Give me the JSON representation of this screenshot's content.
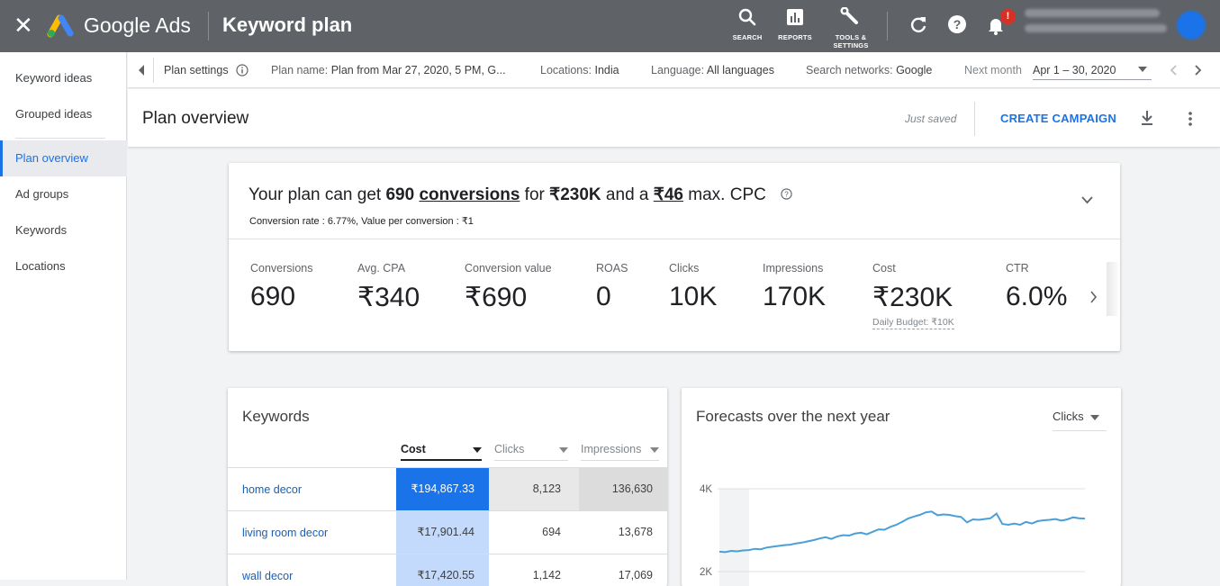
{
  "topbar": {
    "app_name": "Google Ads",
    "page_title": "Keyword plan",
    "tools": {
      "search": "SEARCH",
      "reports": "REPORTS",
      "tools_line1": "TOOLS &",
      "tools_line2": "SETTINGS"
    },
    "notification_badge": "!"
  },
  "sidebar": {
    "items": [
      {
        "label": "Keyword ideas"
      },
      {
        "label": "Grouped ideas"
      },
      {
        "label": "Plan overview"
      },
      {
        "label": "Ad groups"
      },
      {
        "label": "Keywords"
      },
      {
        "label": "Locations"
      }
    ]
  },
  "settings_bar": {
    "plan_settings": "Plan settings",
    "plan_name_label": "Plan name:",
    "plan_name_value": "Plan from Mar 27, 2020, 5 PM, G...",
    "locations_label": "Locations:",
    "locations_value": "India",
    "language_label": "Language:",
    "language_value": "All languages",
    "networks_label": "Search networks:",
    "networks_value": "Google",
    "period_label": "Next month",
    "period_value": "Apr 1 – 30, 2020"
  },
  "overview": {
    "title": "Plan overview",
    "saved_status": "Just saved",
    "create_campaign": "CREATE CAMPAIGN"
  },
  "summary": {
    "h1": "Your plan can get ",
    "h2": "690",
    "h3": "conversions",
    "h4": " for ",
    "h5": "₹230K",
    "h6": " and a ",
    "h7": "₹46",
    "h8": " max. CPC",
    "subline": "Conversion rate : 6.77%, Value per conversion : ₹1",
    "metrics": [
      {
        "label": "Conversions",
        "value": "690"
      },
      {
        "label": "Avg. CPA",
        "value": "₹340"
      },
      {
        "label": "Conversion value",
        "value": "₹690"
      },
      {
        "label": "ROAS",
        "value": "0"
      },
      {
        "label": "Clicks",
        "value": "10K"
      },
      {
        "label": "Impressions",
        "value": "170K"
      },
      {
        "label": "Cost",
        "value": "₹230K",
        "sub": "Daily Budget: ₹10K"
      },
      {
        "label": "CTR",
        "value": "6.0%"
      }
    ]
  },
  "keywords": {
    "title": "Keywords",
    "columns": [
      "Cost",
      "Clicks",
      "Impressions"
    ],
    "rows": [
      {
        "keyword": "home decor",
        "cost": "₹194,867.33",
        "clicks": "8,123",
        "impressions": "136,630"
      },
      {
        "keyword": "living room decor",
        "cost": "₹17,901.44",
        "clicks": "694",
        "impressions": "13,678"
      },
      {
        "keyword": "wall decor",
        "cost": "₹17,420.55",
        "clicks": "1,142",
        "impressions": "17,069"
      }
    ]
  },
  "forecast": {
    "title": "Forecasts over the next year",
    "metric_select": "Clicks",
    "colors": {
      "line": "#4a9fd8"
    },
    "chart_data": {
      "type": "line",
      "y_ticks": [
        "4K",
        "2K"
      ],
      "ylim": [
        2000,
        4000
      ],
      "series": [
        {
          "values": [
            2480,
            2470,
            2500,
            2490,
            2510,
            2520,
            2550,
            2540,
            2580,
            2600,
            2620,
            2640,
            2650,
            2680,
            2700,
            2730,
            2760,
            2800,
            2830,
            2790,
            2850,
            2880,
            2870,
            2920,
            2940,
            2900,
            2960,
            3020,
            3010,
            3080,
            3130,
            3200,
            3280,
            3330,
            3370,
            3430,
            3450,
            3360,
            3380,
            3370,
            3340,
            3320,
            3190,
            3260,
            3250,
            3270,
            3290,
            3400,
            3150,
            3130,
            3160,
            3130,
            3200,
            3160,
            3220,
            3240,
            3250,
            3270,
            3230,
            3260,
            3310,
            3290,
            3280
          ]
        }
      ]
    }
  }
}
